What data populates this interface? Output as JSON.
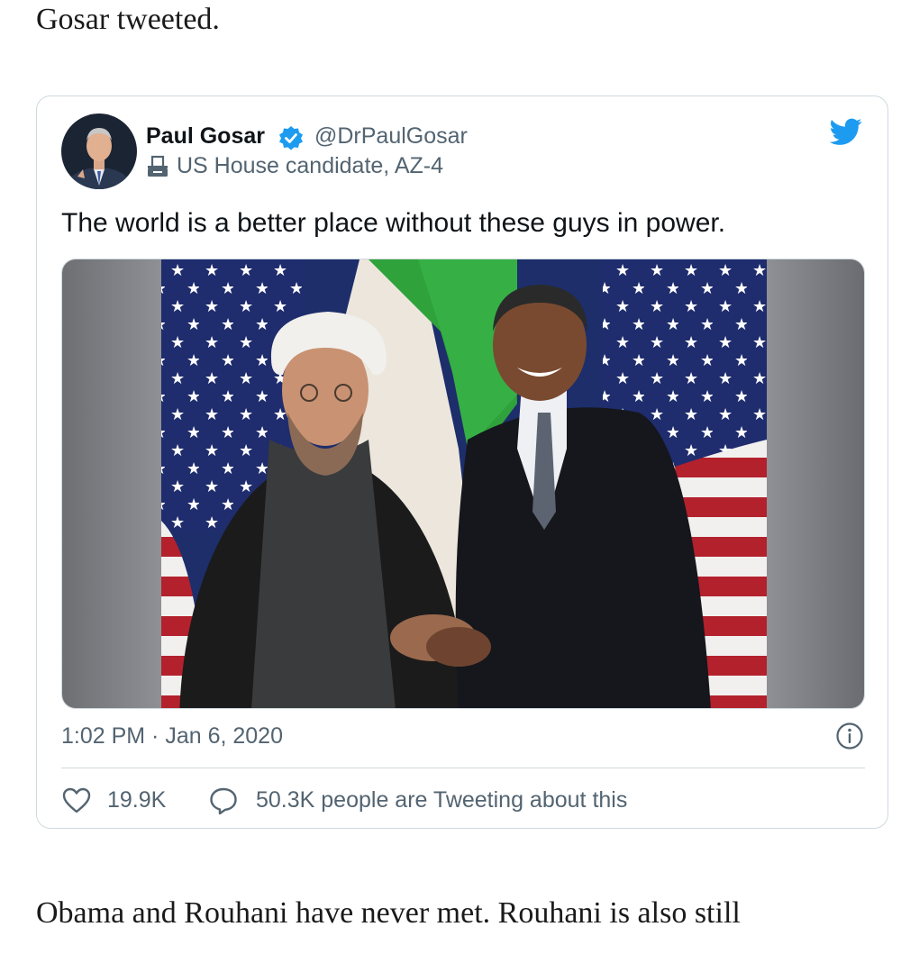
{
  "article": {
    "intro_text": "Gosar tweeted.",
    "outro_text": "Obama and Rouhani have never met. Rouhani is also still"
  },
  "tweet": {
    "author_name": "Paul Gosar",
    "author_handle": "@DrPaulGosar",
    "author_label": "US House candidate, AZ-4",
    "text": "The world is a better place without these guys in power.",
    "timestamp": "1:02 PM · Jan 6, 2020",
    "like_count": "19.9K",
    "tweeting_text": "50.3K people are Tweeting about this"
  },
  "icons": {
    "verified": "verified-badge-icon",
    "ballot": "ballot-box-icon",
    "brand": "twitter-bird-icon",
    "info": "info-icon",
    "like": "heart-icon",
    "reply": "speech-bubble-icon"
  },
  "colors": {
    "twitter_blue": "#1d9bf0",
    "secondary_text": "#536471",
    "border": "#cfd9de"
  }
}
